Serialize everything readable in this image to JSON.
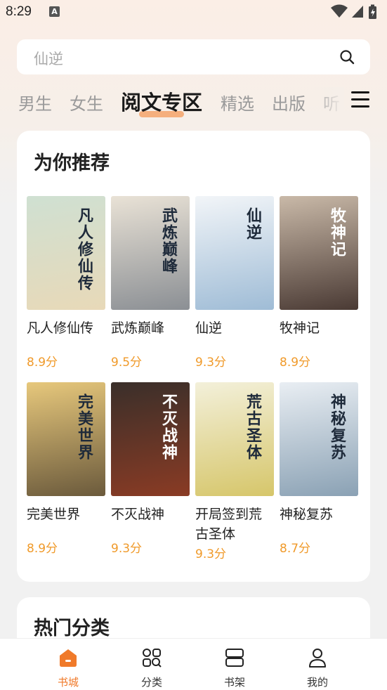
{
  "status": {
    "time": "8:29"
  },
  "search": {
    "placeholder": "仙逆"
  },
  "tabs": [
    "男生",
    "女生",
    "阅文专区",
    "精选",
    "出版",
    "听"
  ],
  "recommend": {
    "title": "为你推荐",
    "books": [
      {
        "name": "凡人修仙传",
        "score": "8.9分",
        "cover_text": "凡人修仙传",
        "colors": [
          "#cfe0d2",
          "#e8d9b8"
        ]
      },
      {
        "name": "武炼巅峰",
        "score": "9.5分",
        "cover_text": "武炼巅峰",
        "colors": [
          "#e9e2d6",
          "#8b8f94"
        ]
      },
      {
        "name": "仙逆",
        "score": "9.3分",
        "cover_text": "仙逆",
        "colors": [
          "#f2f5f8",
          "#9fbcd6"
        ]
      },
      {
        "name": "牧神记",
        "score": "8.9分",
        "cover_text": "牧神记",
        "colors": [
          "#c9b9a8",
          "#4a3a34"
        ]
      },
      {
        "name": "完美世界",
        "score": "8.9分",
        "cover_text": "完美世界",
        "colors": [
          "#e7c87c",
          "#6b5a3c"
        ]
      },
      {
        "name": "不灭战神",
        "score": "9.3分",
        "cover_text": "不灭战神",
        "colors": [
          "#3a2f2a",
          "#8a3b24"
        ]
      },
      {
        "name": "开局签到荒古圣体",
        "score": "9.3分",
        "cover_text": "荒古圣体",
        "colors": [
          "#f3f0da",
          "#d6c66a"
        ]
      },
      {
        "name": "神秘复苏",
        "score": "8.7分",
        "cover_text": "神秘复苏",
        "colors": [
          "#e9eef3",
          "#8aa1b4"
        ]
      }
    ]
  },
  "hot": {
    "title": "热门分类"
  },
  "nav": [
    {
      "label": "书城",
      "icon": "home-icon",
      "active": true
    },
    {
      "label": "分类",
      "icon": "category-icon",
      "active": false
    },
    {
      "label": "书架",
      "icon": "bookshelf-icon",
      "active": false
    },
    {
      "label": "我的",
      "icon": "profile-icon",
      "active": false
    }
  ],
  "accent_color": "#f07a2a",
  "score_color": "#f09a2a"
}
